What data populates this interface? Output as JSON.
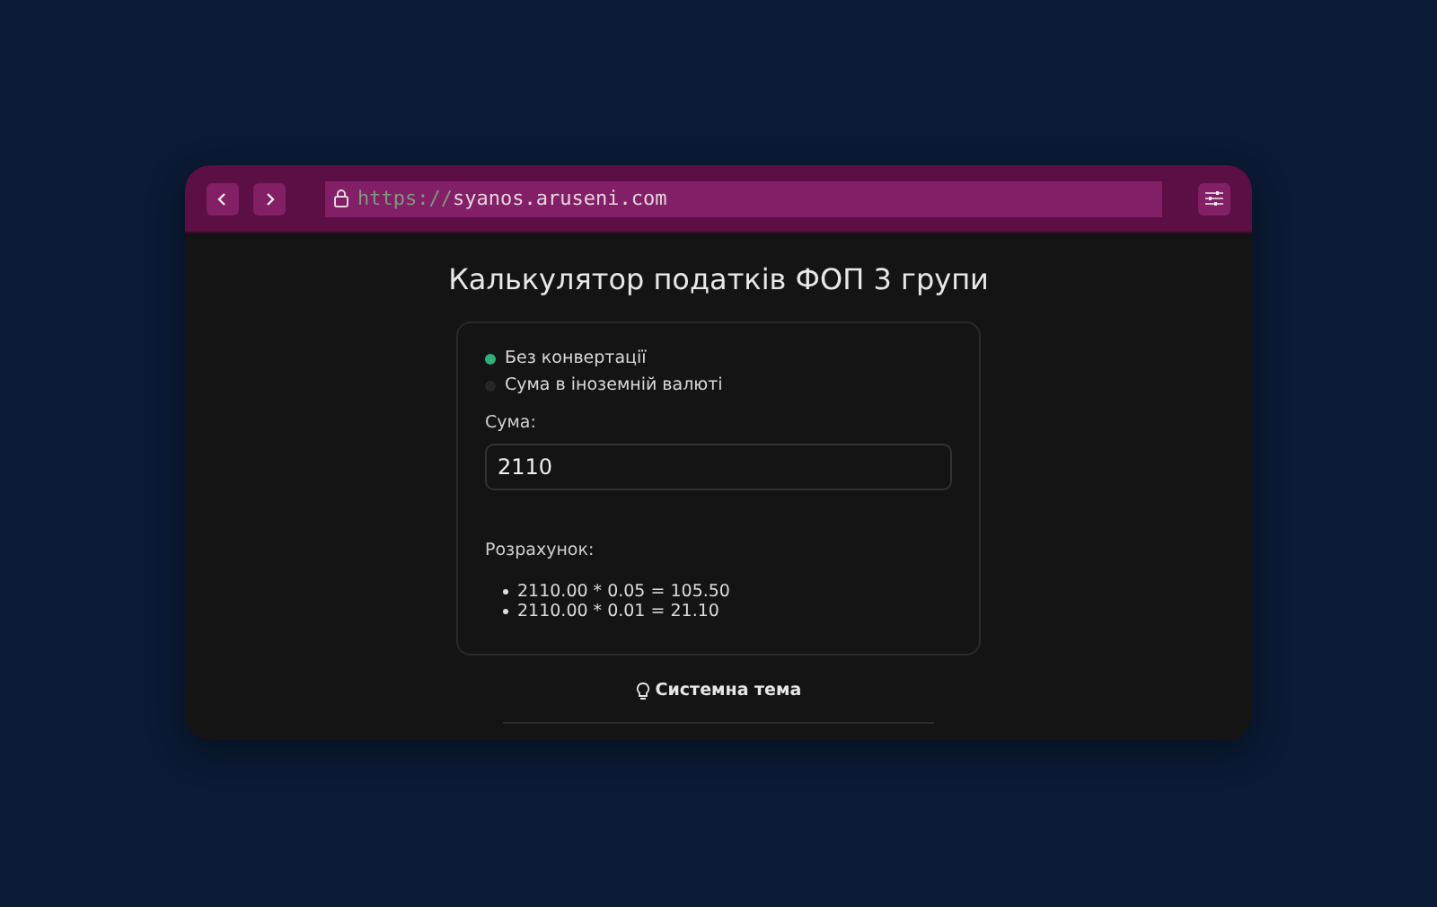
{
  "browser": {
    "url_scheme": "https://",
    "url_host": "syanos.aruseni.com"
  },
  "page": {
    "title": "Калькулятор податків ФОП 3 групи",
    "options": [
      {
        "label": "Без конвертації",
        "selected": true
      },
      {
        "label": "Сума в іноземній валюті",
        "selected": false
      }
    ],
    "amount_label": "Сума:",
    "amount_value": "2110",
    "result_label": "Розрахунок:",
    "results": [
      "2110.00 * 0.05 = 105.50",
      "2110.00 * 0.01 = 21.10"
    ],
    "theme_button": "Системна тема"
  }
}
